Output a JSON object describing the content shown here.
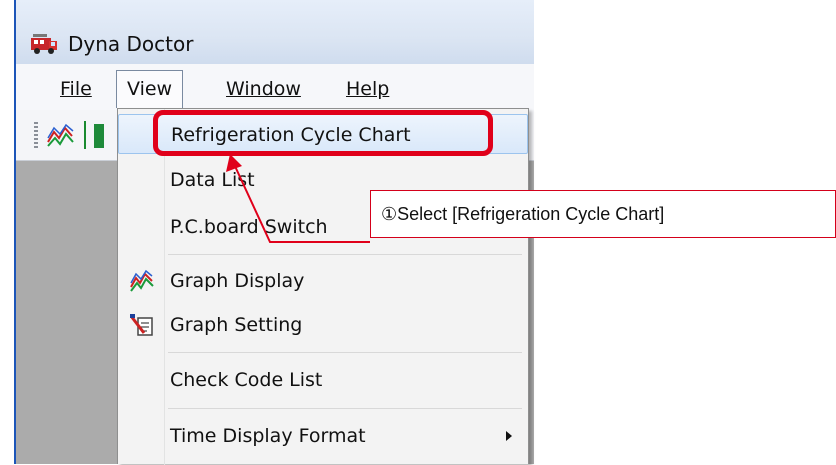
{
  "window": {
    "title": "Dyna Doctor",
    "app_icon": "fire-truck-icon"
  },
  "menubar": {
    "items": [
      {
        "label": "File",
        "open": false
      },
      {
        "label": "View",
        "open": true
      },
      {
        "label": "Window",
        "open": false
      },
      {
        "label": "Help",
        "open": false
      }
    ]
  },
  "toolbar": {
    "icons": [
      "graph-icon",
      "green-indicator-icon"
    ]
  },
  "view_menu": {
    "items": [
      {
        "label": "Refrigeration Cycle Chart",
        "highlighted": true
      },
      {
        "label": "Data List"
      },
      {
        "label": "P.C.board Switch"
      },
      {
        "label": "Graph Display",
        "icon": "graph-icon"
      },
      {
        "label": "Graph Setting",
        "icon": "graph-setting-icon"
      },
      {
        "label": "Check Code List"
      },
      {
        "label": "Time Display Format",
        "submenu": true
      }
    ]
  },
  "annotation": {
    "callout_text": "①Select [Refrigeration Cycle Chart]",
    "color": "#e0001a"
  },
  "colors": {
    "accent": "#e0001a",
    "highlight": "#d9e8fa",
    "workspace": "#ababab"
  }
}
